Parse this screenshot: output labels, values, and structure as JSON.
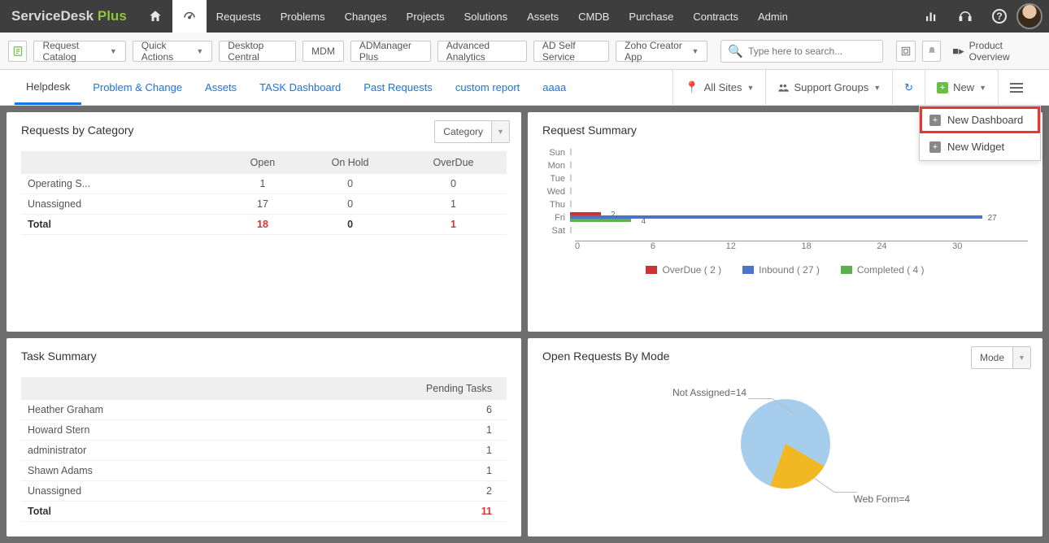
{
  "brand": {
    "a": "ServiceDesk",
    "b": "Plus"
  },
  "topnav": [
    "Requests",
    "Problems",
    "Changes",
    "Projects",
    "Solutions",
    "Assets",
    "CMDB",
    "Purchase",
    "Contracts",
    "Admin"
  ],
  "secondbar": {
    "request_catalog": "Request Catalog",
    "quick_actions": "Quick Actions",
    "items": [
      "Desktop Central",
      "MDM",
      "ADManager Plus",
      "Advanced Analytics",
      "AD Self Service",
      "Zoho Creator App"
    ],
    "search_placeholder": "Type here to search...",
    "product_overview": "Product Overview"
  },
  "thirdbar": {
    "tabs": [
      "Helpdesk",
      "Problem & Change",
      "Assets",
      "TASK Dashboard",
      "Past Requests",
      "custom report",
      "aaaa"
    ],
    "active": 0,
    "all_sites": "All Sites",
    "support_groups": "Support Groups",
    "new": "New"
  },
  "dropdown": {
    "new_dashboard": "New Dashboard",
    "new_widget": "New Widget"
  },
  "panel1": {
    "title": "Requests by Category",
    "select": "Category",
    "headers": [
      "",
      "Open",
      "On Hold",
      "OverDue"
    ],
    "rows": [
      {
        "label": "Operating S...",
        "open": "1",
        "onhold": "0",
        "overdue": "0"
      },
      {
        "label": "Unassigned",
        "open": "17",
        "onhold": "0",
        "overdue": "1"
      }
    ],
    "total": {
      "label": "Total",
      "open": "18",
      "onhold": "0",
      "overdue": "1"
    }
  },
  "panel2": {
    "title": "Request Summary",
    "legend": {
      "overdue": "OverDue ( 2 )",
      "inbound": "Inbound ( 27 )",
      "completed": "Completed ( 4 )"
    }
  },
  "chart_data": {
    "type": "bar",
    "orientation": "horizontal",
    "categories": [
      "Sun",
      "Mon",
      "Tue",
      "Wed",
      "Thu",
      "Fri",
      "Sat"
    ],
    "series": [
      {
        "name": "OverDue",
        "color": "#c33",
        "values": [
          0,
          0,
          0,
          0,
          0,
          2,
          0
        ]
      },
      {
        "name": "Inbound",
        "color": "#4a73c9",
        "values": [
          0,
          0,
          0,
          0,
          0,
          27,
          0
        ]
      },
      {
        "name": "Completed",
        "color": "#5bb14b",
        "values": [
          0,
          0,
          0,
          0,
          0,
          4,
          0
        ]
      }
    ],
    "xlim": [
      0,
      30
    ],
    "xticks": [
      0,
      6,
      12,
      18,
      24,
      30
    ],
    "visible_value_labels": {
      "Fri": {
        "OverDue": 2,
        "Inbound": 27,
        "Completed": 4
      }
    }
  },
  "panel3": {
    "title": "Task Summary",
    "header": "Pending Tasks",
    "rows": [
      {
        "label": "Heather Graham",
        "val": "6"
      },
      {
        "label": "Howard Stern",
        "val": "1"
      },
      {
        "label": "administrator",
        "val": "1"
      },
      {
        "label": "Shawn Adams",
        "val": "1"
      },
      {
        "label": "Unassigned",
        "val": "2"
      }
    ],
    "total": {
      "label": "Total",
      "val": "11"
    }
  },
  "panel4": {
    "title": "Open Requests By Mode",
    "select": "Mode",
    "pie": {
      "type": "pie",
      "slices": [
        {
          "label": "Not Assigned",
          "value": 14,
          "color": "#a6cdec",
          "label_full": "Not Assigned=14"
        },
        {
          "label": "Web Form",
          "value": 4,
          "color": "#f2b824",
          "label_full": "Web Form=4"
        }
      ]
    }
  }
}
